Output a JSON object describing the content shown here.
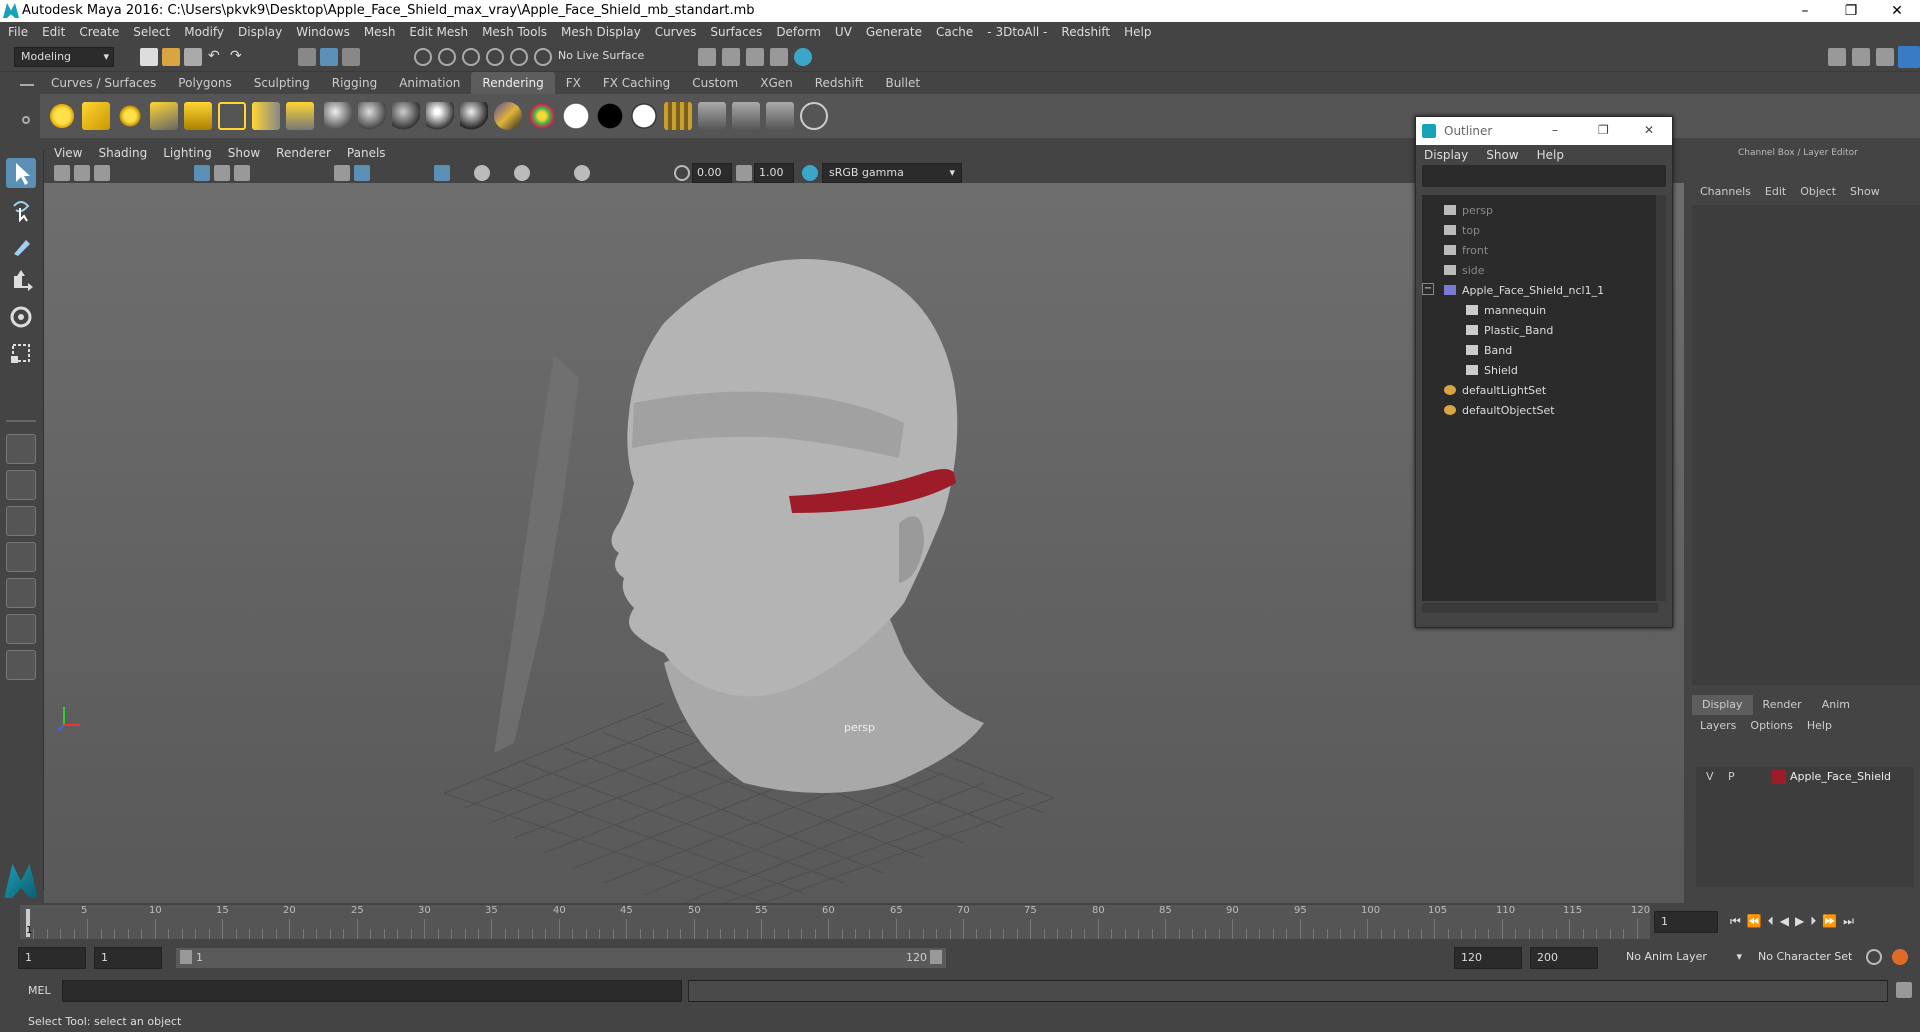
{
  "app": {
    "title": "Autodesk Maya 2016: C:\\Users\\pkvk9\\Desktop\\Apple_Face_Shield_max_vray\\Apple_Face_Shield_mb_standart.mb"
  },
  "window_controls": {
    "minimize": "–",
    "maximize": "❐",
    "close": "✕"
  },
  "menubar": [
    "File",
    "Edit",
    "Create",
    "Select",
    "Modify",
    "Display",
    "Windows",
    "Mesh",
    "Edit Mesh",
    "Mesh Tools",
    "Mesh Display",
    "Curves",
    "Surfaces",
    "Deform",
    "UV",
    "Generate",
    "Cache",
    "- 3DtoAll -",
    "Redshift",
    "Help"
  ],
  "statusline": {
    "mode": "Modeling",
    "live_surface": "No Live Surface"
  },
  "shelf": {
    "tabs": [
      "Curves / Surfaces",
      "Polygons",
      "Sculpting",
      "Rigging",
      "Animation",
      "Rendering",
      "FX",
      "FX Caching",
      "Custom",
      "XGen",
      "Redshift",
      "Bullet"
    ],
    "active_tab": "Rendering"
  },
  "viewport": {
    "menu": [
      "View",
      "Shading",
      "Lighting",
      "Show",
      "Renderer",
      "Panels"
    ],
    "exposure": "0.00",
    "gamma": "1.00",
    "colorspace": "sRGB gamma",
    "camera_label": "persp"
  },
  "outliner": {
    "title": "Outliner",
    "menu": [
      "Display",
      "Show",
      "Help"
    ],
    "items": [
      {
        "label": "persp",
        "dim": true
      },
      {
        "label": "top",
        "dim": true
      },
      {
        "label": "front",
        "dim": true
      },
      {
        "label": "side",
        "dim": true
      },
      {
        "label": "Apple_Face_Shield_ncl1_1",
        "dim": false
      },
      {
        "label": "mannequin",
        "dim": false
      },
      {
        "label": "Plastic_Band",
        "dim": false
      },
      {
        "label": "Band",
        "dim": false
      },
      {
        "label": "Shield",
        "dim": false
      },
      {
        "label": "defaultLightSet",
        "dim": false
      },
      {
        "label": "defaultObjectSet",
        "dim": false
      }
    ],
    "collapse_symbol": "−"
  },
  "channelbox": {
    "title": "Channel Box / Layer Editor",
    "menu": [
      "Channels",
      "Edit",
      "Object",
      "Show"
    ]
  },
  "layer_editor": {
    "tabs": [
      "Display",
      "Render",
      "Anim"
    ],
    "active_tab": "Display",
    "menu": [
      "Layers",
      "Options",
      "Help"
    ],
    "layer": {
      "v": "V",
      "p": "P",
      "name": "Apple_Face_Shield",
      "color": "#9e1c2a"
    }
  },
  "timeline": {
    "ticks": [
      "5",
      "10",
      "15",
      "20",
      "25",
      "30",
      "35",
      "40",
      "45",
      "50",
      "55",
      "60",
      "65",
      "70",
      "75",
      "80",
      "85",
      "90",
      "95",
      "100",
      "105",
      "110",
      "115",
      "120"
    ],
    "current_frame": "1",
    "current_frame_marker": "1"
  },
  "range": {
    "start": "1",
    "start2": "1",
    "inner_start": "1",
    "inner_end": "120",
    "end": "120",
    "end2": "200",
    "anim_layer": "No Anim Layer",
    "char_set": "No Character Set"
  },
  "mel": {
    "label": "MEL"
  },
  "help_line": "Select Tool: select an object",
  "colors": {
    "accent": "#17a2b8",
    "band": "#9e1c2a",
    "shelf_bg": "#555555",
    "panel_bg": "#444444",
    "field_bg": "#2b2b2b"
  }
}
